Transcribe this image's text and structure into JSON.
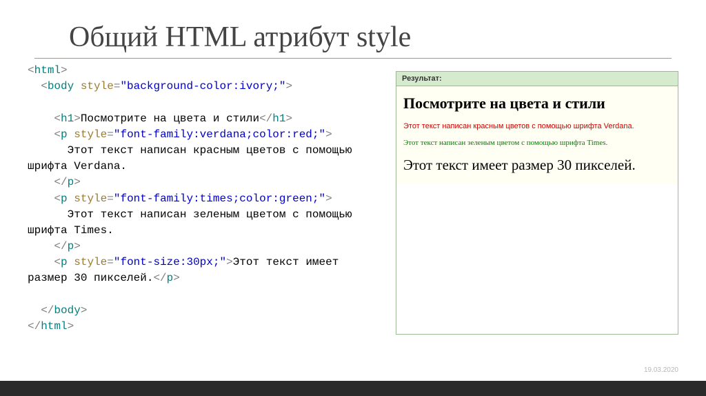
{
  "title": "Общий HTML атрибут style",
  "date": "19.03.2020",
  "code": {
    "l1": {
      "a": "<",
      "tag": "html",
      "b": ">"
    },
    "l2": {
      "a": "<",
      "tag": "body",
      "sp": " ",
      "attr": "style",
      "eq": "=",
      "val": "\"background-color:ivory;\"",
      "b": ">"
    },
    "l3": {
      "a1": "<",
      "tag1": "h1",
      "a2": ">",
      "txt": "Посмотрите на цвета и стили",
      "a3": "</",
      "tag2": "h1",
      "a4": ">"
    },
    "l4": {
      "a": "<",
      "tag": "p",
      "sp": " ",
      "attr": "style",
      "eq": "=",
      "val": "\"font-family:verdana;color:red;\"",
      "b": ">"
    },
    "l5": "      Этот текст написан красным цветов с помощью шрифта Verdana.",
    "l6": {
      "a": "</",
      "tag": "p",
      "b": ">"
    },
    "l7": {
      "a": "<",
      "tag": "p",
      "sp": " ",
      "attr": "style",
      "eq": "=",
      "val": "\"font-family:times;color:green;\"",
      "b": ">"
    },
    "l8": "      Этот текст написан зеленым цветом с помощью шрифта Times.",
    "l9": {
      "a": "</",
      "tag": "p",
      "b": ">"
    },
    "l10": {
      "a": "<",
      "tag": "p",
      "sp": " ",
      "attr": "style",
      "eq": "=",
      "val": "\"font-size:30px;\"",
      "b": ">",
      "txt": "Этот текст имеет размер 30 пикселей.",
      "c": "</",
      "tag2": "p",
      "d": ">"
    },
    "l11": {
      "a": "</",
      "tag": "body",
      "b": ">"
    },
    "l12": {
      "a": "</",
      "tag": "html",
      "b": ">"
    }
  },
  "result": {
    "header": "Результат:",
    "h1": "Посмотрите на цвета и стили",
    "red": "Этот текст написан красным цветов с помощью шрифта Verdana.",
    "green": "Этот текст написан зеленым цветом с помощью шрифта Times.",
    "big": "Этот текст имеет размер 30 пикселей."
  }
}
